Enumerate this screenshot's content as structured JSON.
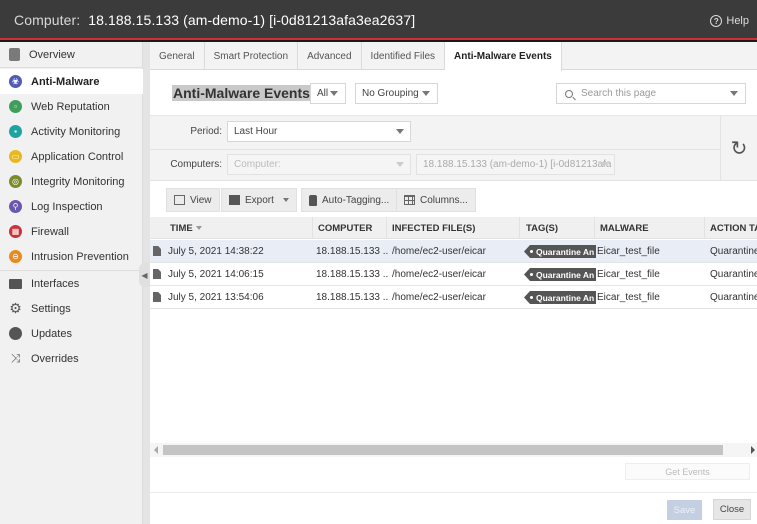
{
  "window": {
    "title_label": "Computer:",
    "title_value": "18.188.15.133 (am-demo-1) [i-0d81213afa3ea2637]",
    "help_label": "Help"
  },
  "sidebar": {
    "items": [
      {
        "label": "Overview",
        "icon": "overview-icon",
        "color": "#7a7a7a"
      },
      {
        "label": "Anti-Malware",
        "icon": "biohazard-icon",
        "color": "#4f5bb5",
        "active": true
      },
      {
        "label": "Web Reputation",
        "icon": "web-reputation-icon",
        "color": "#3f9e5c"
      },
      {
        "label": "Activity Monitoring",
        "icon": "activity-monitoring-icon",
        "color": "#1fa3a0"
      },
      {
        "label": "Application Control",
        "icon": "application-control-icon",
        "color": "#e8b81e"
      },
      {
        "label": "Integrity Monitoring",
        "icon": "integrity-monitoring-icon",
        "color": "#7d8a2c"
      },
      {
        "label": "Log Inspection",
        "icon": "log-inspection-icon",
        "color": "#6b57b0"
      },
      {
        "label": "Firewall",
        "icon": "firewall-icon",
        "color": "#c8323a"
      },
      {
        "label": "Intrusion Prevention",
        "icon": "intrusion-prevention-icon",
        "color": "#e98a1c"
      },
      {
        "label": "Interfaces",
        "icon": "interfaces-icon",
        "color": "#555555"
      },
      {
        "label": "Settings",
        "icon": "gear-icon",
        "color": "#555555"
      },
      {
        "label": "Updates",
        "icon": "updates-icon",
        "color": "#555555"
      },
      {
        "label": "Overrides",
        "icon": "shuffle-icon",
        "color": "#555555"
      }
    ]
  },
  "tabs": [
    {
      "label": "General"
    },
    {
      "label": "Smart Protection"
    },
    {
      "label": "Advanced"
    },
    {
      "label": "Identified Files"
    },
    {
      "label": "Anti-Malware Events",
      "active": true
    }
  ],
  "header": {
    "title": "Anti-Malware Events",
    "filter_value": "All",
    "grouping_value": "No Grouping",
    "search_placeholder": "Search this page"
  },
  "filters": {
    "period_label": "Period:",
    "period_value": "Last Hour",
    "computers_label": "Computers:",
    "computers_value": "Computer:",
    "computer_selected": "18.188.15.133 (am-demo-1) [i-0d81213afa"
  },
  "toolbar": {
    "view_label": "View",
    "export_label": "Export",
    "auto_tagging_label": "Auto-Tagging...",
    "columns_label": "Columns..."
  },
  "table": {
    "columns": [
      "TIME",
      "COMPUTER",
      "INFECTED FILE(S)",
      "TAG(S)",
      "MALWARE",
      "ACTION TA"
    ],
    "rows": [
      {
        "time": "July 5, 2021 14:38:22",
        "computer": "18.188.15.133 ...",
        "file": "/home/ec2-user/eicar",
        "tag": "Quarantine An",
        "malware": "Eicar_test_file",
        "action": "Quarantined",
        "selected": true
      },
      {
        "time": "July 5, 2021 14:06:15",
        "computer": "18.188.15.133 ...",
        "file": "/home/ec2-user/eicar",
        "tag": "Quarantine An",
        "malware": "Eicar_test_file",
        "action": "Quarantined"
      },
      {
        "time": "July 5, 2021 13:54:06",
        "computer": "18.188.15.133 ...",
        "file": "/home/ec2-user/eicar",
        "tag": "Quarantine An",
        "malware": "Eicar_test_file",
        "action": "Quarantined"
      }
    ]
  },
  "footer": {
    "get_events_label": "Get Events",
    "save_label": "Save",
    "close_label": "Close"
  }
}
